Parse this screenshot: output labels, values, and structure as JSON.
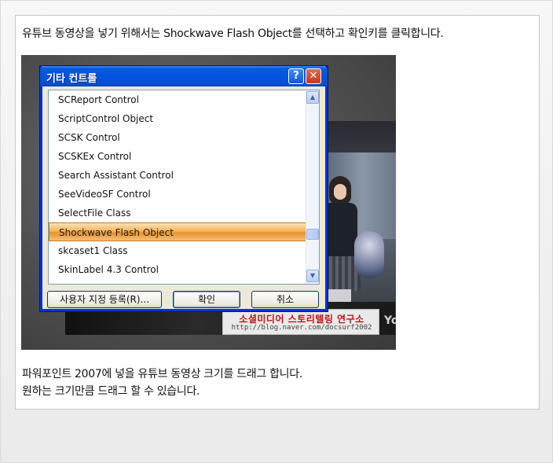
{
  "captions": {
    "top": "유튜브 동영상을 넣기 위해서는 Shockwave Flash Object를 선택하고 확인키를 클릭합니다.",
    "bottom_line1": "파워포인트 2007에 넣을 유튜브 동영상 크기를 드래그 합니다.",
    "bottom_line2": "원하는 크기만큼 드래그 할 수 있습니다."
  },
  "dialog": {
    "title": "기타 컨트롤",
    "help_label": "?",
    "close_label": "✕",
    "items": [
      "SCReport Control",
      "ScriptControl Object",
      "SCSK Control",
      "SCSKEx Control",
      "Search Assistant Control",
      "SeeVideoSF Control",
      "SelectFile Class",
      "Shockwave Flash Object",
      "skcaset1 Class",
      "SkinLabel 4.3 Control"
    ],
    "selected_index": 7,
    "buttons": {
      "register": "사용자 지정 등록(R)...",
      "ok": "확인",
      "cancel": "취소"
    },
    "scroll_up": "▲",
    "scroll_down": "▼"
  },
  "banner": {
    "title": "소셜미디어 스토리텔링 연구소",
    "url": "http://blog.naver.com/docsurf2002"
  },
  "video_mark": "Yo",
  "colors": {
    "title_bar": "#0054e3",
    "selection": "#f6b35c",
    "banner_text": "#c0140f"
  }
}
